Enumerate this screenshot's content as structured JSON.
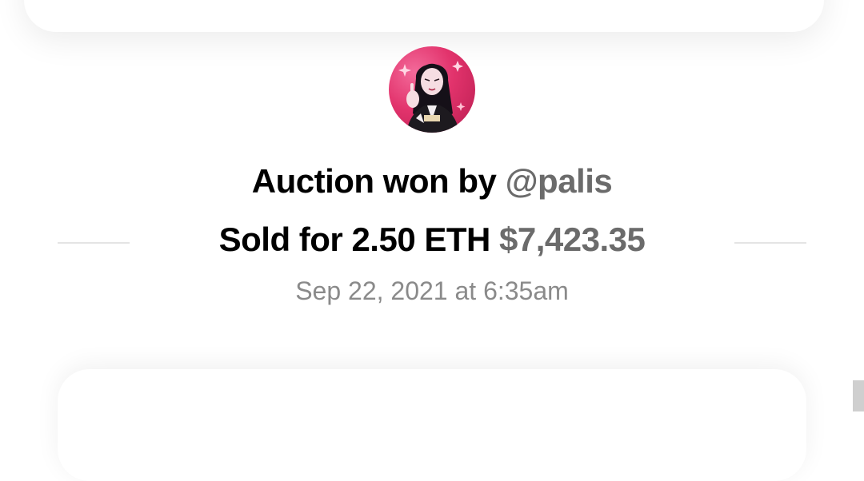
{
  "auction": {
    "won_by_label": "Auction won by",
    "winner_handle": "@palis",
    "sold_for_label": "Sold for",
    "price_eth": "2.50 ETH",
    "price_usd": "$7,423.35",
    "date": "Sep 22, 2021 at 6:35am"
  },
  "avatar": {
    "icon": "winner-avatar-illustration"
  },
  "colors": {
    "text_primary": "#000000",
    "text_secondary": "#6b6b6b",
    "text_meta": "#8a8a8a",
    "avatar_accent": "#e2336c"
  }
}
